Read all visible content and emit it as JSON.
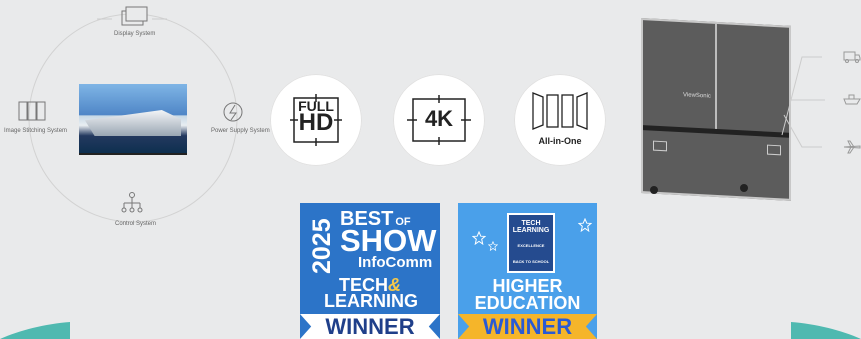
{
  "systems": {
    "display": "Display System",
    "stitching": "Image Stitching System",
    "power": "Power Supply System",
    "control": "Control System"
  },
  "features": {
    "fullhd_line1": "FULL",
    "fullhd_line2": "HD",
    "fourk": "4K",
    "allinone": "All-in-One"
  },
  "case": {
    "brand": "ViewSonic"
  },
  "badges": {
    "infocomm": {
      "year": "2025",
      "best": "BEST",
      "of": "OF",
      "show": "SHOW",
      "event": "InfoComm",
      "tech": "TECH",
      "amp": "&",
      "learning": "LEARNING",
      "result": "WINNER"
    },
    "education": {
      "logo_tech": "TECH",
      "logo_learning": "LEARNING",
      "logo_excellence": "EXCELLENCE",
      "logo_back": "BACK TO SCHOOL",
      "line1": "HIGHER",
      "line2": "EDUCATION",
      "result": "WINNER"
    }
  },
  "colors": {
    "background": "#e9eaeb",
    "badge_blue": "#2c74c8",
    "badge_light_blue": "#4aa0ea",
    "ribbon_gold": "#f5b52a"
  }
}
